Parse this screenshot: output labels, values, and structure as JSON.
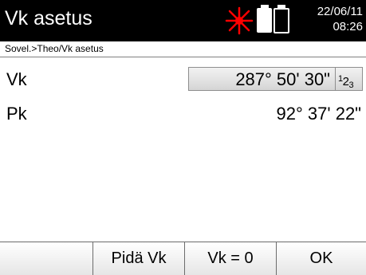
{
  "header": {
    "title": "Vk asetus",
    "date": "22/06/11",
    "time": "08:26",
    "icons": [
      "laser-icon",
      "battery-full-icon",
      "battery-empty-icon"
    ],
    "laser_color": "#ff0000"
  },
  "breadcrumb": {
    "text": "Sovel.>Theo/Vk asetus"
  },
  "fields": {
    "vk": {
      "label": "Vk",
      "value": "287° 50' 30\"",
      "input_mode": "1 2 3"
    },
    "pk": {
      "label": "Pk",
      "value": "92° 37' 22\""
    }
  },
  "softkeys": [
    "",
    "Pidä Vk",
    "Vk = 0",
    "OK"
  ]
}
